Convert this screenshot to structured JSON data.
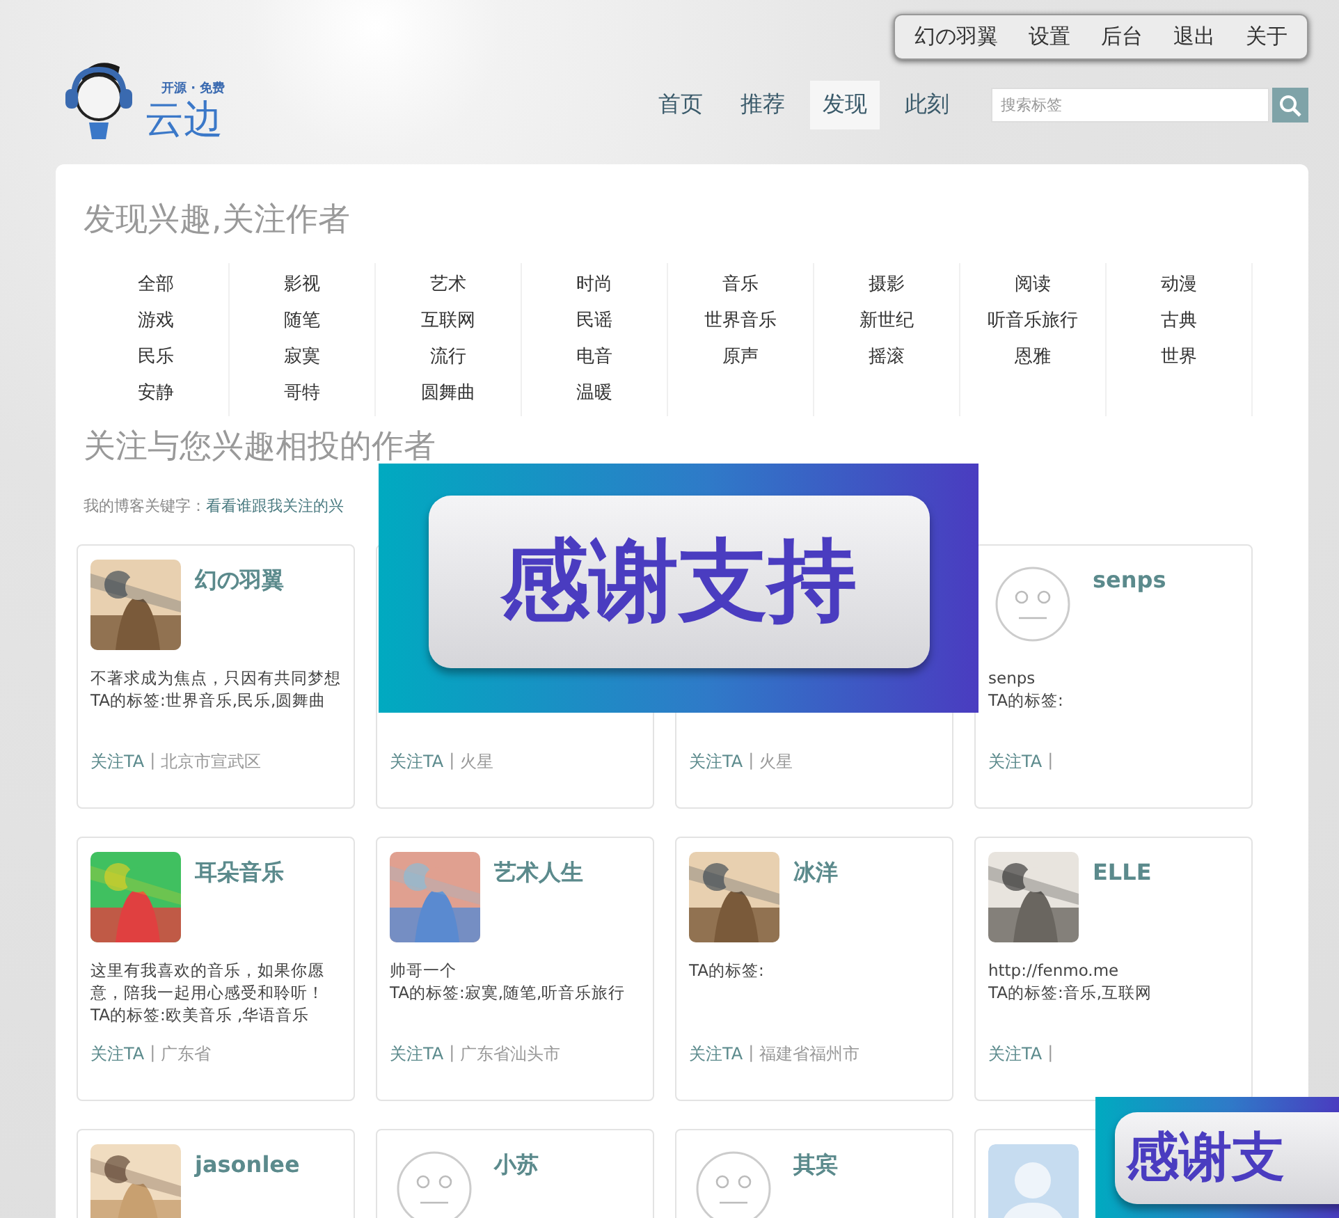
{
  "header": {
    "logo": {
      "tagline": "开源 · 免费",
      "name": "云边"
    },
    "user_menu": [
      "幻の羽翼",
      "设置",
      "后台",
      "退出",
      "关于"
    ],
    "nav": [
      {
        "label": "首页",
        "selected": false
      },
      {
        "label": "推荐",
        "selected": false
      },
      {
        "label": "发现",
        "selected": true
      },
      {
        "label": "此刻",
        "selected": false
      }
    ],
    "search": {
      "placeholder": "搜索标签"
    }
  },
  "discover": {
    "title": "发现兴趣,关注作者",
    "tag_columns": [
      [
        "全部",
        "游戏",
        "民乐",
        "安静"
      ],
      [
        "影视",
        "随笔",
        "寂寞",
        "哥特"
      ],
      [
        "艺术",
        "互联网",
        "流行",
        "圆舞曲"
      ],
      [
        "时尚",
        "民谣",
        "电音",
        "温暖"
      ],
      [
        "音乐",
        "世界音乐",
        "原声"
      ],
      [
        "摄影",
        "新世纪",
        "摇滚"
      ],
      [
        "阅读",
        "听音乐旅行",
        "恩雅"
      ],
      [
        "动漫",
        "古典",
        "世界"
      ]
    ]
  },
  "authors": {
    "title": "关注与您兴趣相投的作者",
    "keywords_label": "我的博客关键字：",
    "keywords_link": "看看谁跟我关注的兴",
    "cards": [
      {
        "kind": "picture",
        "name": "幻の羽翼",
        "description": [
          " 不著求成为焦点，只因有共同梦想",
          "TA的标签:世界音乐,民乐,圆舞曲"
        ],
        "follow": "关注TA",
        "separator": "|",
        "location": "北京市宣武区"
      },
      {
        "follow": "关注TA",
        "separator": "|",
        "location": "火星"
      },
      {
        "follow": "关注TA",
        "separator": "|",
        "location": "火星"
      },
      {
        "kind": "default",
        "name": "senps",
        "description": [
          "senps",
          "TA的标签:"
        ],
        "follow": "关注TA",
        "separator": "|"
      },
      {
        "kind": "picture",
        "name": "耳朵音乐",
        "description": [
          "这里有我喜欢的音乐，如果你愿意，陪我一起用心感受和聆听！",
          "TA的标签:欧美音乐 ,华语音乐"
        ],
        "follow": "关注TA",
        "separator": "|",
        "location": "广东省"
      },
      {
        "kind": "picture",
        "name": "艺术人生",
        "description": [
          "帅哥一个",
          "TA的标签:寂寞,随笔,听音乐旅行"
        ],
        "follow": "关注TA",
        "separator": "|",
        "location": "广东省汕头市"
      },
      {
        "kind": "picture",
        "name": "冰洋",
        "description": [
          "TA的标签:"
        ],
        "follow": "关注TA",
        "separator": "|",
        "location": "福建省福州市"
      },
      {
        "kind": "picture",
        "name": "ELLE",
        "description": [
          "http://fenmo.me",
          "TA的标签:音乐,互联网"
        ],
        "follow": "关注TA",
        "separator": "|"
      },
      {
        "kind": "picture",
        "name": "jasonlee"
      },
      {
        "kind": "default",
        "name": "小苏"
      },
      {
        "kind": "default",
        "name": "其宾"
      },
      {
        "kind": "silhouette"
      }
    ]
  },
  "overlays": [
    {
      "text": "感谢支持"
    },
    {
      "text": "感谢支"
    }
  ]
}
